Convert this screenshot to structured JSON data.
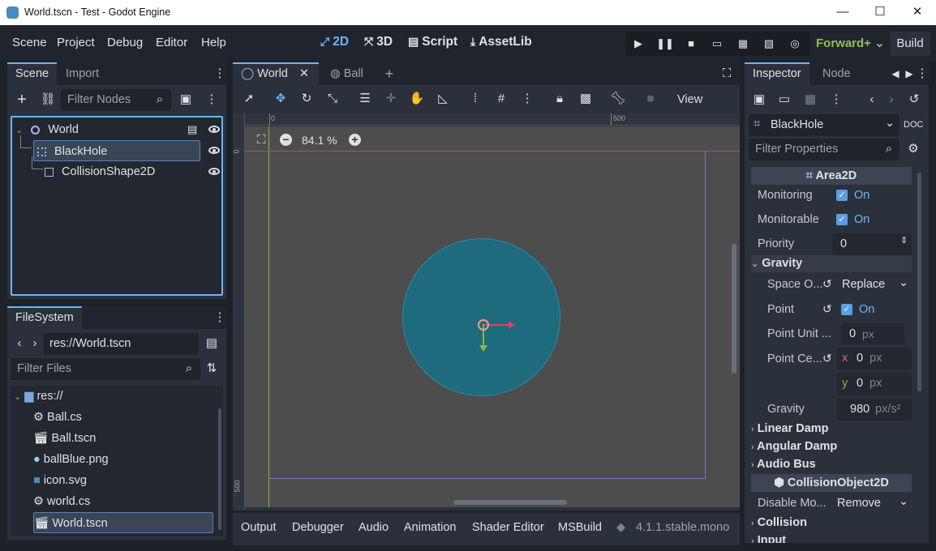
{
  "window": {
    "title": "World.tscn - Test - Godot Engine",
    "minimize": "—",
    "maximize": "☐",
    "close": "✕"
  },
  "menu": {
    "items": [
      "Scene",
      "Project",
      "Debug",
      "Editor",
      "Help"
    ]
  },
  "modes": {
    "m2d": "2D",
    "m3d": "3D",
    "script": "Script",
    "assetlib": "AssetLib"
  },
  "renderer": "Forward+",
  "build": "Build",
  "scene_dock": {
    "tabs": [
      "Scene",
      "Import"
    ],
    "filter_placeholder": "Filter Nodes",
    "nodes": [
      {
        "name": "World",
        "depth": 0
      },
      {
        "name": "BlackHole",
        "depth": 1,
        "selected": true
      },
      {
        "name": "CollisionShape2D",
        "depth": 2
      }
    ]
  },
  "filesystem": {
    "tab": "FileSystem",
    "path": "res://World.tscn",
    "filter_placeholder": "Filter Files",
    "root": "res://",
    "files": [
      "Ball.cs",
      "Ball.tscn",
      "ballBlue.png",
      "icon.svg",
      "world.cs",
      "World.tscn"
    ],
    "selected": "World.tscn"
  },
  "viewport": {
    "tabs": [
      "World",
      "Ball"
    ],
    "view_menu": "View",
    "zoom": "84.1 %",
    "ruler_top": [
      "0",
      "500"
    ],
    "ruler_left": [
      "0",
      "500"
    ],
    "colors": {
      "circle": "#1e6b7d",
      "canvas": "#4d4d4d",
      "accent": "#6eb4f7"
    }
  },
  "bottom_tabs": [
    "Output",
    "Debugger",
    "Audio",
    "Animation",
    "Shader Editor",
    "MSBuild"
  ],
  "version": "4.1.1.stable.mono",
  "inspector": {
    "tabs": [
      "Inspector",
      "Node"
    ],
    "node": "BlackHole",
    "filter_placeholder": "Filter Properties",
    "class1": "Area2D",
    "monitoring_label": "Monitoring",
    "monitoring_val": "On",
    "monitorable_label": "Monitorable",
    "monitorable_val": "On",
    "priority_label": "Priority",
    "priority_val": "0",
    "gravity_section": "Gravity",
    "space_label": "Space O...",
    "space_val": "Replace",
    "point_label": "Point",
    "point_val": "On",
    "unit_label": "Point Unit ...",
    "unit_val": "0",
    "unit_suffix": "px",
    "center_label": "Point Ce...",
    "center_x_label": "x",
    "center_x": "0",
    "center_y_label": "y",
    "center_y": "0",
    "center_suffix": "px",
    "gravity_label": "Gravity",
    "gravity_val": "980",
    "gravity_suffix": "px/s²",
    "linear_damp": "Linear Damp",
    "angular_damp": "Angular Damp",
    "audio_bus": "Audio Bus",
    "class2": "CollisionObject2D",
    "disable_label": "Disable Mo...",
    "disable_val": "Remove",
    "collision": "Collision",
    "input": "Input"
  }
}
